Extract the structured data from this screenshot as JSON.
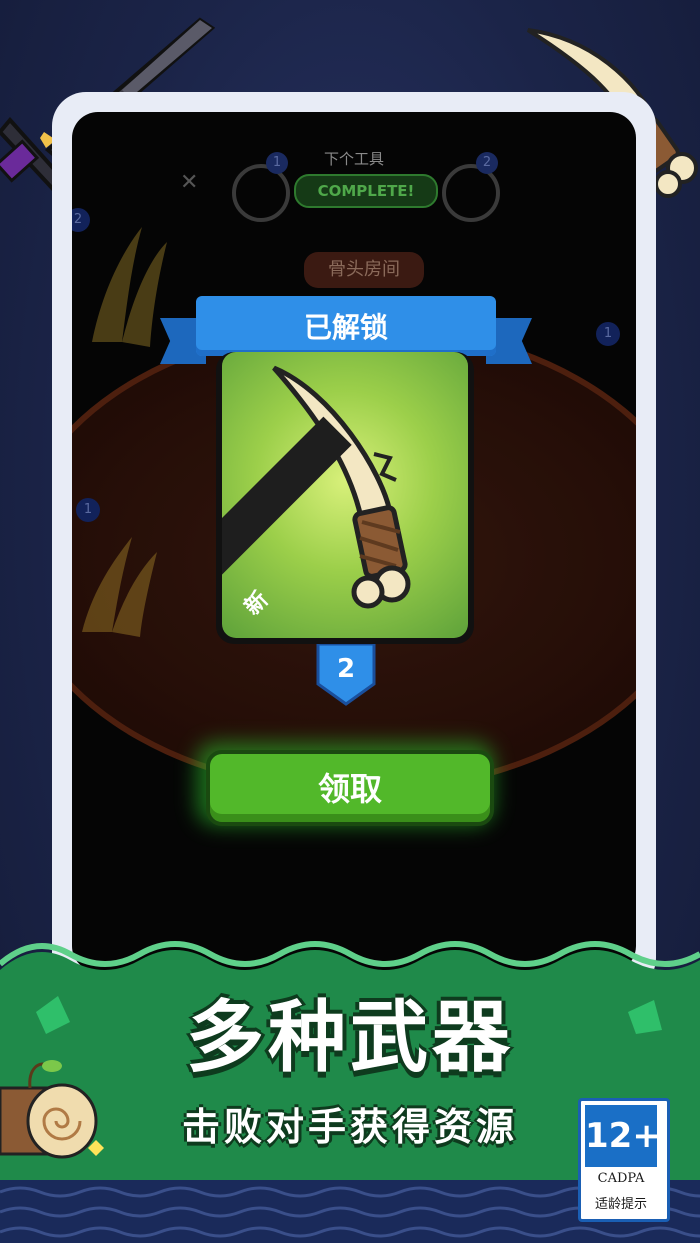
{
  "hud": {
    "next_tool_label": "下个工具",
    "complete_label": "COMPLETE!",
    "left_ring_badge": "1",
    "right_ring_badge": "2",
    "room_name": "骨头房间",
    "side_badges": [
      "2",
      "1",
      "1"
    ]
  },
  "unlock": {
    "ribbon_title": "已解锁",
    "new_tag": "新",
    "level": "2",
    "claim_button": "领取"
  },
  "promo": {
    "title": "多种武器",
    "subtitle": "击败对手获得资源"
  },
  "age_rating": {
    "value": "12+",
    "org": "CADPA",
    "label": "适龄提示"
  },
  "colors": {
    "ribbon_blue": "#2f8fe8",
    "claim_green": "#52b82a",
    "banner_green": "#1f8a4a",
    "card_green": "#9ccf4a"
  }
}
